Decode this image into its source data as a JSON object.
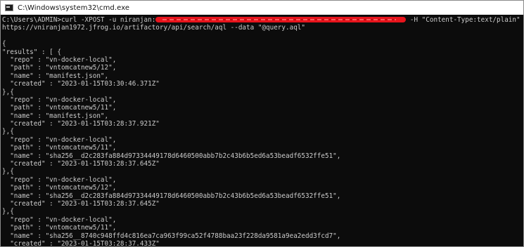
{
  "window": {
    "title": "C:\\Windows\\system32\\cmd.exe"
  },
  "console": {
    "command_prompt": "C:\\Users\\ADMIN>curl -XPOST -u niranjan:",
    "command_suffix": " -H \"Content-Type:text/plain\"",
    "command_line2": "https://vniranjan1972.jfrog.io/artifactory/api/search/aql --data \"@query.aql\"",
    "output": [
      "",
      "{",
      "\"results\" : [ {",
      "  \"repo\" : \"vn-docker-local\",",
      "  \"path\" : \"vntomcatnew5/12\",",
      "  \"name\" : \"manifest.json\",",
      "  \"created\" : \"2023-01-15T03:30:46.371Z\"",
      "},{",
      "  \"repo\" : \"vn-docker-local\",",
      "  \"path\" : \"vntomcatnew5/11\",",
      "  \"name\" : \"manifest.json\",",
      "  \"created\" : \"2023-01-15T03:28:37.921Z\"",
      "},{",
      "  \"repo\" : \"vn-docker-local\",",
      "  \"path\" : \"vntomcatnew5/11\",",
      "  \"name\" : \"sha256__d2c283fa884d97334449178d6460500abb7b2c43b6b5ed6a53beadf6532ffe51\",",
      "  \"created\" : \"2023-01-15T03:28:37.645Z\"",
      "},{",
      "  \"repo\" : \"vn-docker-local\",",
      "  \"path\" : \"vntomcatnew5/12\",",
      "  \"name\" : \"sha256__d2c283fa884d97334449178d6460500abb7b2c43b6b5ed6a53beadf6532ffe51\",",
      "  \"created\" : \"2023-01-15T03:28:37.645Z\"",
      "},{",
      "  \"repo\" : \"vn-docker-local\",",
      "  \"path\" : \"vntomcatnew5/11\",",
      "  \"name\" : \"sha256__8740c948ffd4c816ea7ca963f99ca52f4788baa23f228da9581a9ea2edd3fcd7\",",
      "  \"created\" : \"2023-01-15T03:28:37.433Z\""
    ]
  }
}
